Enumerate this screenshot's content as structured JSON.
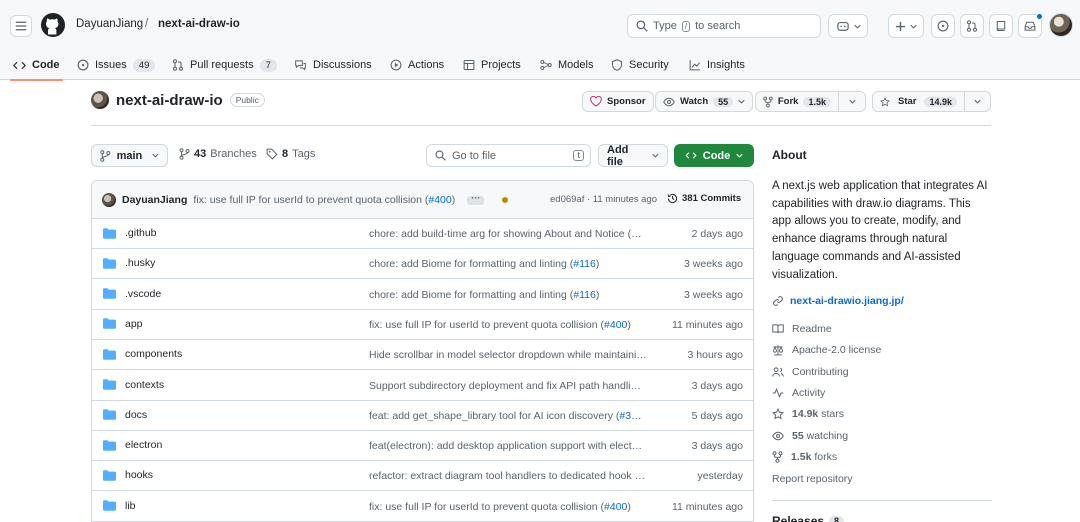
{
  "header": {
    "owner": "DayuanJiang",
    "separator": "/",
    "repo": "next-ai-draw-io",
    "search_prefix": "Type",
    "search_key": "/",
    "search_suffix": "to search"
  },
  "tabs": [
    {
      "label": "Code",
      "count": null,
      "icon": "code-icon",
      "selected": true
    },
    {
      "label": "Issues",
      "count": "49",
      "icon": "issue-icon"
    },
    {
      "label": "Pull requests",
      "count": "7",
      "icon": "pull-request-icon"
    },
    {
      "label": "Discussions",
      "count": null,
      "icon": "discussion-icon"
    },
    {
      "label": "Actions",
      "count": null,
      "icon": "play-icon"
    },
    {
      "label": "Projects",
      "count": null,
      "icon": "table-icon"
    },
    {
      "label": "Models",
      "count": null,
      "icon": "models-icon"
    },
    {
      "label": "Security",
      "count": null,
      "icon": "shield-icon"
    },
    {
      "label": "Insights",
      "count": null,
      "icon": "graph-icon"
    }
  ],
  "repo": {
    "name": "next-ai-draw-io",
    "visibility": "Public",
    "sponsor": "Sponsor",
    "watch": "Watch",
    "watch_count": "55",
    "fork": "Fork",
    "fork_count": "1.5k",
    "star": "Star",
    "star_count": "14.9k"
  },
  "toolbar": {
    "branch": "main",
    "branches_count": "43",
    "branches_label": "Branches",
    "tags_count": "8",
    "tags_label": "Tags",
    "goto_placeholder": "Go to file",
    "goto_key": "t",
    "add_file": "Add file",
    "code": "Code"
  },
  "latest_commit": {
    "author": "DayuanJiang",
    "message": "fix: use full IP for userId to prevent quota collision (",
    "pr": "#400",
    "message_end": ")",
    "hash_time": "ed069af · 11 minutes ago",
    "commits": "381 Commits"
  },
  "files": [
    {
      "name": ".github",
      "msg": "chore: add build-time arg for showing About and Notice (…",
      "pr": "",
      "msg_end": "",
      "time": "2 days ago"
    },
    {
      "name": ".husky",
      "msg": "chore: add Biome for formatting and linting (",
      "pr": "#116",
      "msg_end": ")",
      "time": "3 weeks ago"
    },
    {
      "name": ".vscode",
      "msg": "chore: add Biome for formatting and linting (",
      "pr": "#116",
      "msg_end": ")",
      "time": "3 weeks ago"
    },
    {
      "name": "app",
      "msg": "fix: use full IP for userId to prevent quota collision (",
      "pr": "#400",
      "msg_end": ")",
      "time": "11 minutes ago"
    },
    {
      "name": "components",
      "msg": "Hide scrollbar in model selector dropdown while maintaini…",
      "pr": "",
      "msg_end": "",
      "time": "3 hours ago"
    },
    {
      "name": "contexts",
      "msg": "Support subdirectory deployment and fix API path handli…",
      "pr": "",
      "msg_end": "",
      "time": "3 days ago"
    },
    {
      "name": "docs",
      "msg": "feat: add get_shape_library tool for AI icon discovery (",
      "pr": "#3…",
      "msg_end": "",
      "time": "5 days ago"
    },
    {
      "name": "electron",
      "msg": "feat(electron): add desktop application support with elect…",
      "pr": "",
      "msg_end": "",
      "time": "3 days ago"
    },
    {
      "name": "hooks",
      "msg": "refactor: extract diagram tool handlers to dedicated hook …",
      "pr": "",
      "msg_end": "",
      "time": "yesterday"
    },
    {
      "name": "lib",
      "msg": "fix: use full IP for userId to prevent quota collision (",
      "pr": "#400",
      "msg_end": ")",
      "time": "11 minutes ago"
    }
  ],
  "about": {
    "title": "About",
    "description": "A next.js web application that integrates AI capabilities with draw.io diagrams. This app allows you to create, modify, and enhance diagrams through natural language commands and AI-assisted visualization.",
    "website": "next-ai-drawio.jiang.jp/",
    "readme": "Readme",
    "license": "Apache-2.0 license",
    "contributing": "Contributing",
    "activity": "Activity",
    "stars_count": "14.9k",
    "stars_label": "stars",
    "watching_count": "55",
    "watching_label": "watching",
    "forks_count": "1.5k",
    "forks_label": "forks",
    "report": "Report repository"
  },
  "releases": {
    "title": "Releases",
    "count": "8"
  },
  "colors": {
    "accent": "#0969da",
    "primary_button": "#1f883d",
    "tab_underline": "#fd8c73",
    "folder": "#54aeff"
  }
}
